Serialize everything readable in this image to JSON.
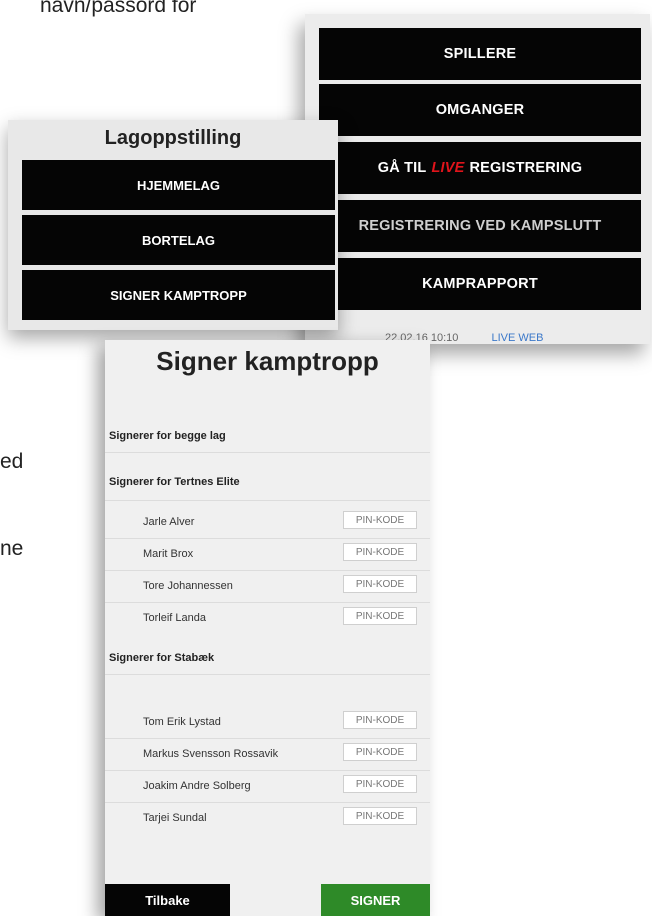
{
  "document_text": {
    "line1": "navn/passord for",
    "line2": "ed",
    "line3": "ne"
  },
  "menu": {
    "items": [
      {
        "label": "SPILLERE"
      },
      {
        "label": "OMGANGER"
      },
      {
        "label_prefix": "GÅ TIL",
        "label_accent": "LIVE",
        "label_suffix": "REGISTRERING"
      },
      {
        "label": "REGISTRERING VED KAMPSLUTT"
      },
      {
        "label": "KAMPRAPPORT"
      }
    ],
    "meta_time": "22.02.16 10:10",
    "meta_link": "LIVE WEB",
    "accent_color": "#e0141b"
  },
  "lineup": {
    "title": "Lagoppstilling",
    "items": [
      {
        "label": "HJEMMELAG"
      },
      {
        "label": "BORTELAG"
      },
      {
        "label": "SIGNER KAMPTROPP"
      }
    ]
  },
  "sign": {
    "title": "Signer kamptropp",
    "both_teams_label": "Signerer for begge lag",
    "pin_placeholder": "PIN-KODE",
    "teams": [
      {
        "heading": "Signerer for Tertnes Elite",
        "players": [
          "Jarle Alver",
          "Marit Brox",
          "Tore Johannessen",
          "Torleif Landa"
        ]
      },
      {
        "heading": "Signerer for Stabæk",
        "players": [
          "Tom Erik Lystad",
          "Markus Svensson Rossavik",
          "Joakim Andre Solberg",
          "Tarjei Sundal"
        ]
      }
    ],
    "back_label": "Tilbake",
    "submit_label": "SIGNER",
    "submit_color": "#2e8a28"
  }
}
